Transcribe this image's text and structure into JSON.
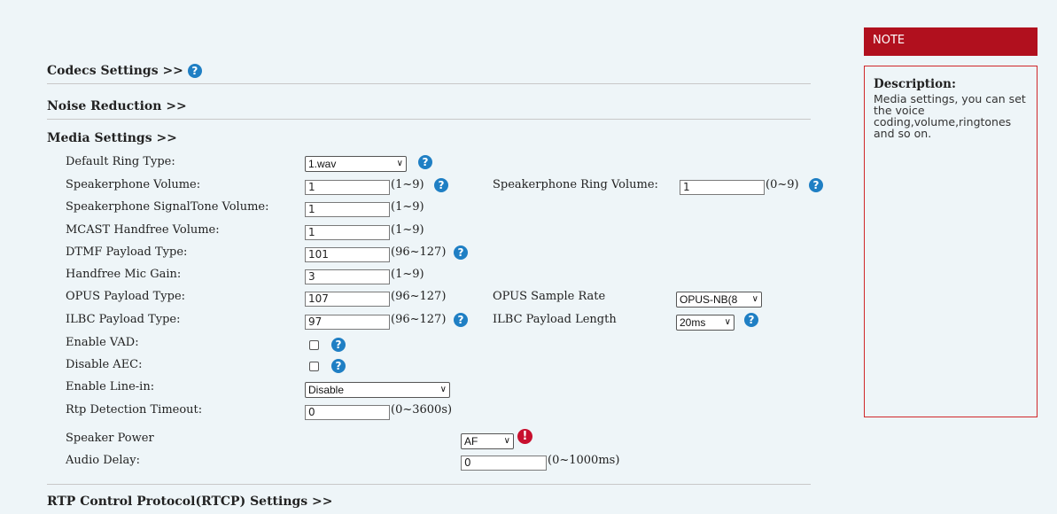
{
  "sections": {
    "codecs": "Codecs Settings >>",
    "noise": "Noise Reduction >>",
    "media": "Media Settings >>",
    "rtcp": "RTP Control Protocol(RTCP) Settings >>"
  },
  "media": {
    "default_ring_type": {
      "label": "Default Ring Type:",
      "value": "1.wav"
    },
    "speakerphone_volume": {
      "label": "Speakerphone Volume:",
      "value": "1",
      "range": "(1~9)"
    },
    "speakerphone_ring_volume": {
      "label": "Speakerphone Ring Volume:",
      "value": "1",
      "range": "(0~9)"
    },
    "speakerphone_signaltone_volume": {
      "label": "Speakerphone SignalTone Volume:",
      "value": "1",
      "range": "(1~9)"
    },
    "mcast_handfree_volume": {
      "label": "MCAST Handfree Volume:",
      "value": "1",
      "range": "(1~9)"
    },
    "dtmf_payload_type": {
      "label": "DTMF Payload Type:",
      "value": "101",
      "range": "(96~127)"
    },
    "handfree_mic_gain": {
      "label": "Handfree Mic Gain:",
      "value": "3",
      "range": "(1~9)"
    },
    "opus_payload_type": {
      "label": "OPUS Payload Type:",
      "value": "107",
      "range": "(96~127)"
    },
    "opus_sample_rate": {
      "label": "OPUS Sample Rate",
      "value": "OPUS-NB(8"
    },
    "ilbc_payload_type": {
      "label": "ILBC Payload Type:",
      "value": "97",
      "range": "(96~127)"
    },
    "ilbc_payload_length": {
      "label": "ILBC Payload Length",
      "value": "20ms"
    },
    "enable_vad": {
      "label": "Enable VAD:"
    },
    "disable_aec": {
      "label": "Disable AEC:"
    },
    "enable_line_in": {
      "label": "Enable Line-in:",
      "value": "Disable"
    },
    "rtp_detection_timeout": {
      "label": "Rtp Detection Timeout:",
      "value": "0",
      "range": "(0~3600s)"
    },
    "speaker_power": {
      "label": "Speaker Power",
      "value": "AF"
    },
    "audio_delay": {
      "label": "Audio Delay:",
      "value": "0",
      "range": "(0~1000ms)"
    }
  },
  "note": {
    "title": "NOTE",
    "desc_title": "Description:",
    "desc_text": "Media settings, you can set the voice coding,volume,ringtones and so on."
  },
  "icons": {
    "help": "?",
    "warn": "!"
  },
  "colors": {
    "note_header": "#b1101e",
    "help_icon": "#1f7fc4",
    "warn_icon": "#c8102e",
    "background": "#eef5f8"
  }
}
